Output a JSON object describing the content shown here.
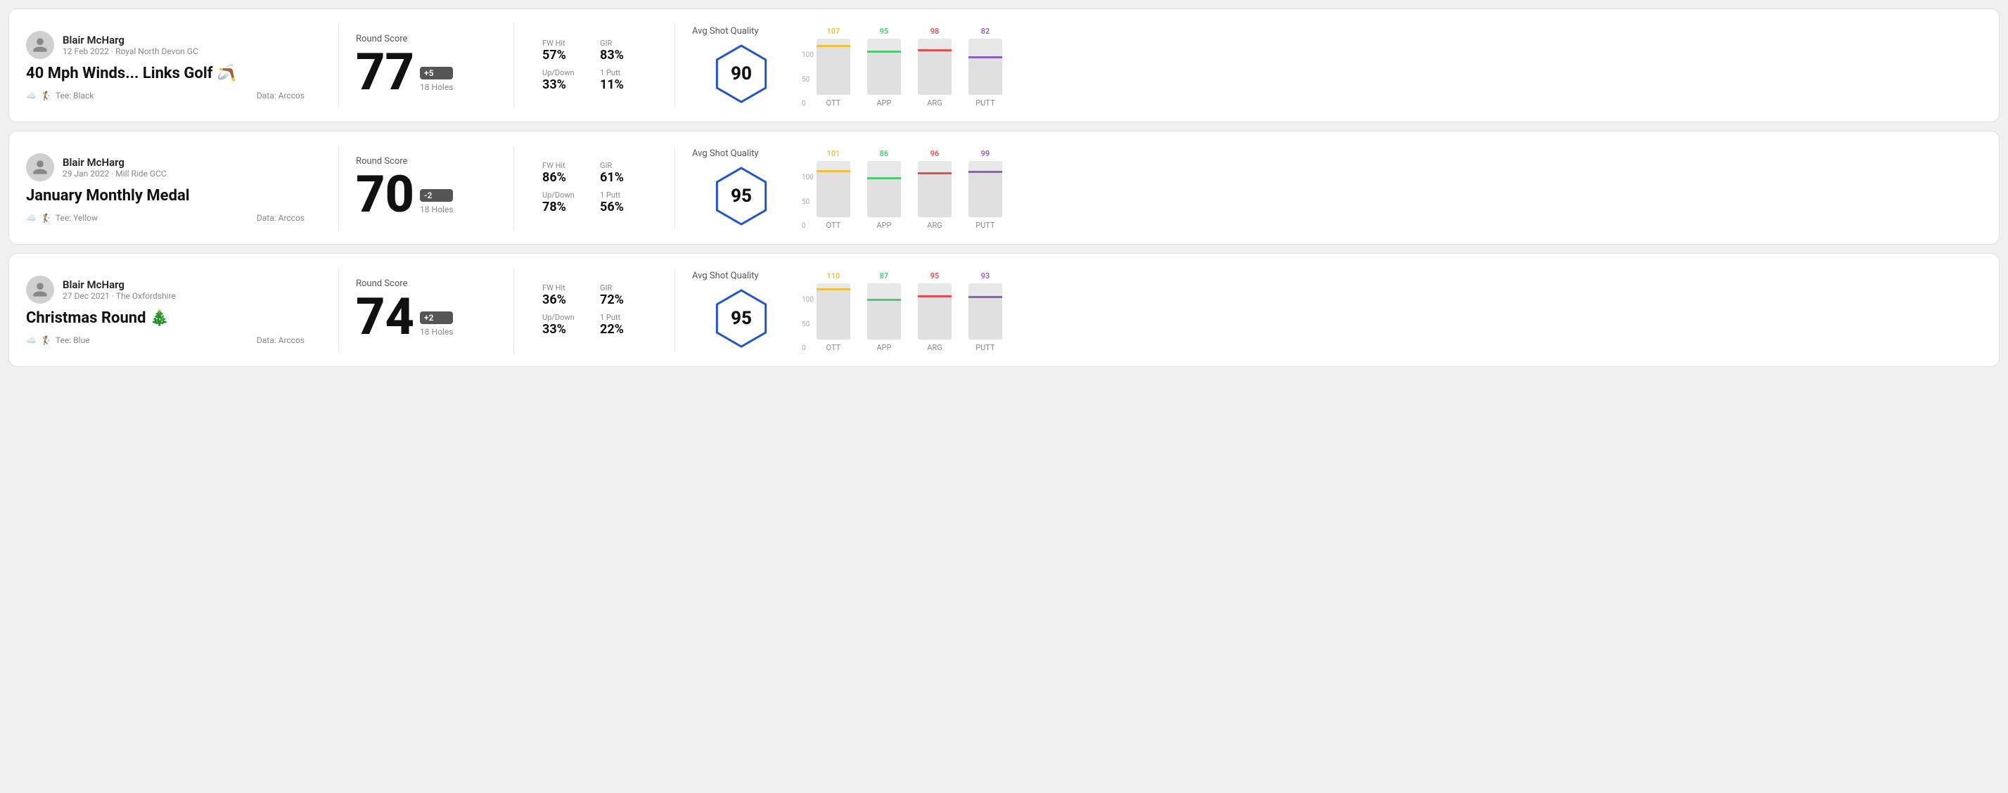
{
  "rounds": [
    {
      "id": "round-1",
      "user": {
        "name": "Blair McHarg",
        "meta": "12 Feb 2022 · Royal North Devon GC"
      },
      "title": "40 Mph Winds... Links Golf 🪃",
      "tee": "Black",
      "data_source": "Arccos",
      "round_score_label": "Round Score",
      "score": "77",
      "score_diff": "+5",
      "holes": "18 Holes",
      "fw_hit_label": "FW Hit",
      "fw_hit": "57%",
      "gir_label": "GIR",
      "gir": "83%",
      "updown_label": "Up/Down",
      "updown": "33%",
      "oneputt_label": "1 Putt",
      "oneputt": "11%",
      "quality_label": "Avg Shot Quality",
      "quality_score": "90",
      "chart": {
        "bars": [
          {
            "label": "OTT",
            "value": 107,
            "color": "#f0c040",
            "max": 120
          },
          {
            "label": "APP",
            "value": 95,
            "color": "#50c878",
            "max": 120
          },
          {
            "label": "ARG",
            "value": 98,
            "color": "#e05050",
            "max": 120
          },
          {
            "label": "PUTT",
            "value": 82,
            "color": "#9060c0",
            "max": 120
          }
        ],
        "y_labels": [
          "100",
          "50",
          "0"
        ]
      }
    },
    {
      "id": "round-2",
      "user": {
        "name": "Blair McHarg",
        "meta": "29 Jan 2022 · Mill Ride GCC"
      },
      "title": "January Monthly Medal",
      "tee": "Yellow",
      "data_source": "Arccos",
      "round_score_label": "Round Score",
      "score": "70",
      "score_diff": "-2",
      "holes": "18 Holes",
      "fw_hit_label": "FW Hit",
      "fw_hit": "86%",
      "gir_label": "GIR",
      "gir": "61%",
      "updown_label": "Up/Down",
      "updown": "78%",
      "oneputt_label": "1 Putt",
      "oneputt": "56%",
      "quality_label": "Avg Shot Quality",
      "quality_score": "95",
      "chart": {
        "bars": [
          {
            "label": "OTT",
            "value": 101,
            "color": "#f0c040",
            "max": 120
          },
          {
            "label": "APP",
            "value": 86,
            "color": "#50c878",
            "max": 120
          },
          {
            "label": "ARG",
            "value": 96,
            "color": "#e05050",
            "max": 120
          },
          {
            "label": "PUTT",
            "value": 99,
            "color": "#9060c0",
            "max": 120
          }
        ],
        "y_labels": [
          "100",
          "50",
          "0"
        ]
      }
    },
    {
      "id": "round-3",
      "user": {
        "name": "Blair McHarg",
        "meta": "27 Dec 2021 · The Oxfordshire"
      },
      "title": "Christmas Round 🎄",
      "tee": "Blue",
      "data_source": "Arccos",
      "round_score_label": "Round Score",
      "score": "74",
      "score_diff": "+2",
      "holes": "18 Holes",
      "fw_hit_label": "FW Hit",
      "fw_hit": "36%",
      "gir_label": "GIR",
      "gir": "72%",
      "updown_label": "Up/Down",
      "updown": "33%",
      "oneputt_label": "1 Putt",
      "oneputt": "22%",
      "quality_label": "Avg Shot Quality",
      "quality_score": "95",
      "chart": {
        "bars": [
          {
            "label": "OTT",
            "value": 110,
            "color": "#f0c040",
            "max": 120
          },
          {
            "label": "APP",
            "value": 87,
            "color": "#50c878",
            "max": 120
          },
          {
            "label": "ARG",
            "value": 95,
            "color": "#e05050",
            "max": 120
          },
          {
            "label": "PUTT",
            "value": 93,
            "color": "#9060c0",
            "max": 120
          }
        ],
        "y_labels": [
          "100",
          "50",
          "0"
        ]
      }
    }
  ]
}
